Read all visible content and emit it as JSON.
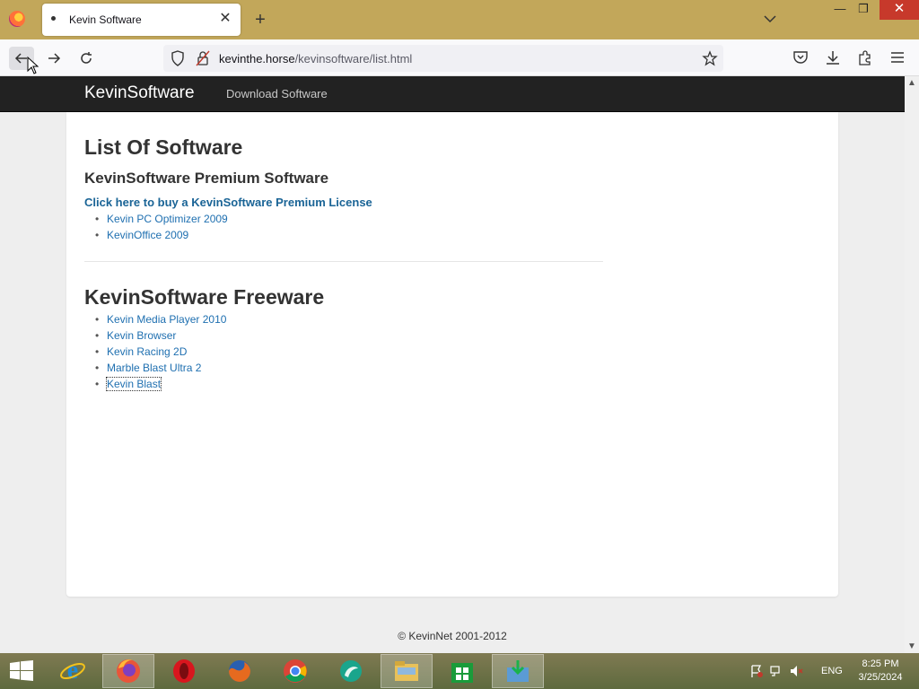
{
  "browser": {
    "tab_title": "Kevin Software",
    "url_host": "kevinthe.horse",
    "url_path": "/kevinsoftware/list.html"
  },
  "site": {
    "brand": "KevinSoftware",
    "nav_link": "Download Software",
    "title": "List Of Software",
    "premium_heading": "KevinSoftware Premium Software",
    "buy_link": "Click here to buy a KevinSoftware Premium License",
    "premium_items": [
      "Kevin PC Optimizer 2009",
      "KevinOffice 2009"
    ],
    "freeware_heading": "KevinSoftware Freeware",
    "freeware_items": [
      "Kevin Media Player 2010",
      "Kevin Browser",
      "Kevin Racing 2D",
      "Marble Blast Ultra 2",
      "Kevin Blast"
    ],
    "footer": "© KevinNet 2001-2012"
  },
  "taskbar": {
    "apps": [
      "internet-explorer",
      "firefox",
      "opera",
      "firefox-legacy",
      "chrome",
      "maxthon",
      "file-explorer",
      "store",
      "installer"
    ],
    "active_app": "firefox",
    "language": "ENG",
    "time": "8:25 PM",
    "date": "3/25/2024"
  }
}
